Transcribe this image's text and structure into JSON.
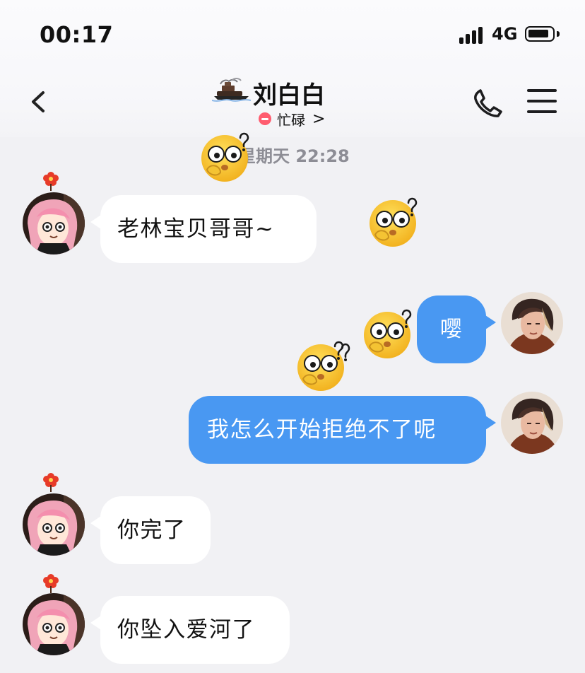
{
  "status_bar": {
    "time": "00:17",
    "network": "4G"
  },
  "header": {
    "title": "刘白白",
    "status": "忙碌",
    "status_chevron": ">"
  },
  "conversation": {
    "timestamp": "星期天 22:28"
  },
  "messages": [
    {
      "side": "left",
      "text": "老林宝贝哥哥~"
    },
    {
      "side": "right",
      "text": "嘤"
    },
    {
      "side": "right",
      "text": "我怎么开始拒绝不了呢"
    },
    {
      "side": "left",
      "text": "你完了"
    },
    {
      "side": "left",
      "text": "你坠入爱河了"
    }
  ],
  "theme": {
    "background": "#f1f1f4",
    "bubble_left": "#ffffff",
    "bubble_right": "#4998f2",
    "busy_status": "#ff5c6f"
  },
  "icons": {
    "back": "chevron-left-icon",
    "phone": "phone-icon",
    "menu": "hamburger-menu-icon",
    "emoji": "surprised-question-emoji"
  }
}
